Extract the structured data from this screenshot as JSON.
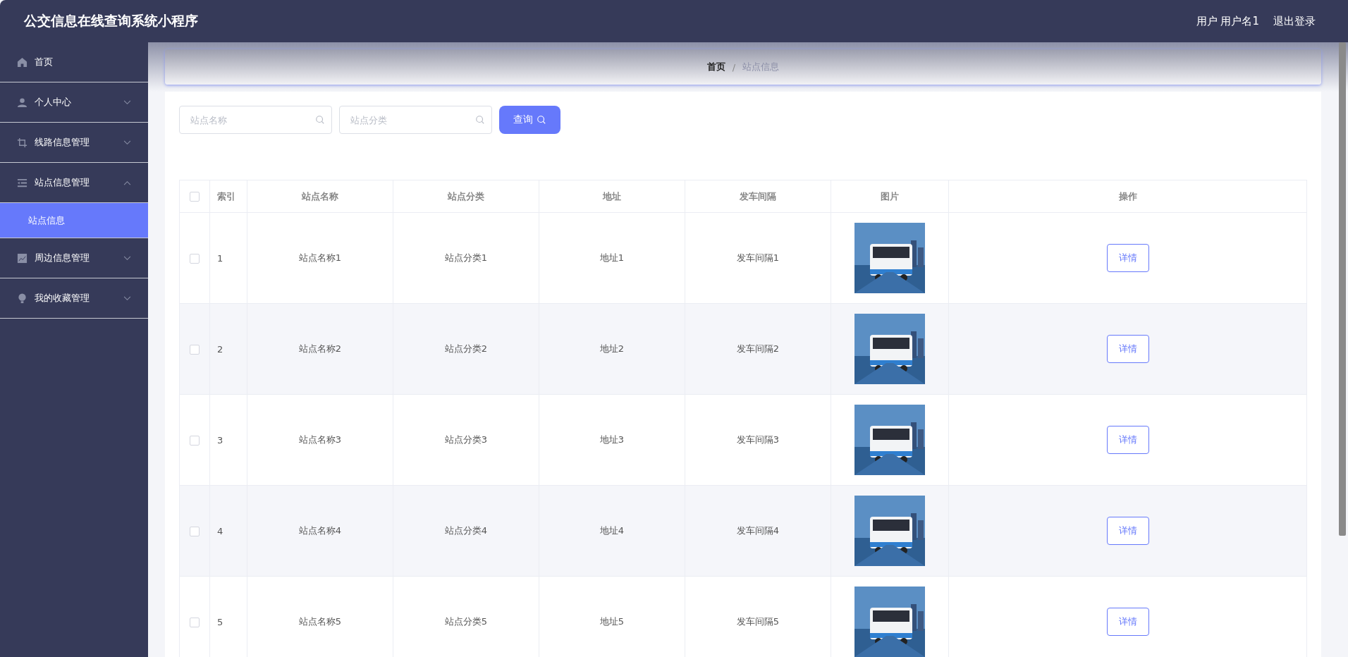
{
  "header": {
    "title": "公交信息在线查询系统小程序",
    "user": "用户 用户名1",
    "logout": "退出登录"
  },
  "sidebar": {
    "items": [
      {
        "label": "首页"
      },
      {
        "label": "个人中心",
        "expanded": false
      },
      {
        "label": "线路信息管理",
        "expanded": false
      },
      {
        "label": "站点信息管理",
        "expanded": true,
        "children": [
          {
            "label": "站点信息",
            "selected": true
          }
        ]
      },
      {
        "label": "周边信息管理",
        "expanded": false
      },
      {
        "label": "我的收藏管理",
        "expanded": false
      }
    ]
  },
  "breadcrumb": {
    "items": [
      "首页",
      "站点信息"
    ],
    "separator": "/"
  },
  "search": {
    "fields": [
      {
        "placeholder": "站点名称"
      },
      {
        "placeholder": "站点分类"
      }
    ],
    "button": "查询"
  },
  "table": {
    "all_checked": false,
    "columns": [
      "索引",
      "站点名称",
      "站点分类",
      "地址",
      "发车间隔",
      "图片",
      "操作"
    ],
    "rows": [
      {
        "checked": false,
        "index": "1",
        "name": "站点名称1",
        "category": "站点分类1",
        "address": "地址1",
        "interval": "发车间隔1",
        "action": "详情"
      },
      {
        "checked": false,
        "index": "2",
        "name": "站点名称2",
        "category": "站点分类2",
        "address": "地址2",
        "interval": "发车间隔2",
        "action": "详情"
      },
      {
        "checked": false,
        "index": "3",
        "name": "站点名称3",
        "category": "站点分类3",
        "address": "地址3",
        "interval": "发车间隔3",
        "action": "详情"
      },
      {
        "checked": false,
        "index": "4",
        "name": "站点名称4",
        "category": "站点分类4",
        "address": "地址4",
        "interval": "发车间隔4",
        "action": "详情"
      },
      {
        "checked": false,
        "index": "5",
        "name": "站点名称5",
        "category": "站点分类5",
        "address": "地址5",
        "interval": "发车间隔5",
        "action": "详情"
      }
    ]
  }
}
